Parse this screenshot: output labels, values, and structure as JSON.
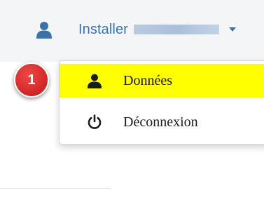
{
  "navbar": {
    "user_icon": "user-icon",
    "user_label": "Installer",
    "caret_icon": "caret-down-icon"
  },
  "dropdown": {
    "items": [
      {
        "label": "Données",
        "icon": "user-icon",
        "highlighted": true,
        "highlight_color": "#ffff00"
      },
      {
        "label": "Déconnexion",
        "icon": "power-icon"
      }
    ]
  },
  "annotation": {
    "badge_number": "1",
    "badge_color": "#d42a2a"
  },
  "colors": {
    "link": "#3b72a8",
    "navbar_bg": "#f4f5f7"
  }
}
